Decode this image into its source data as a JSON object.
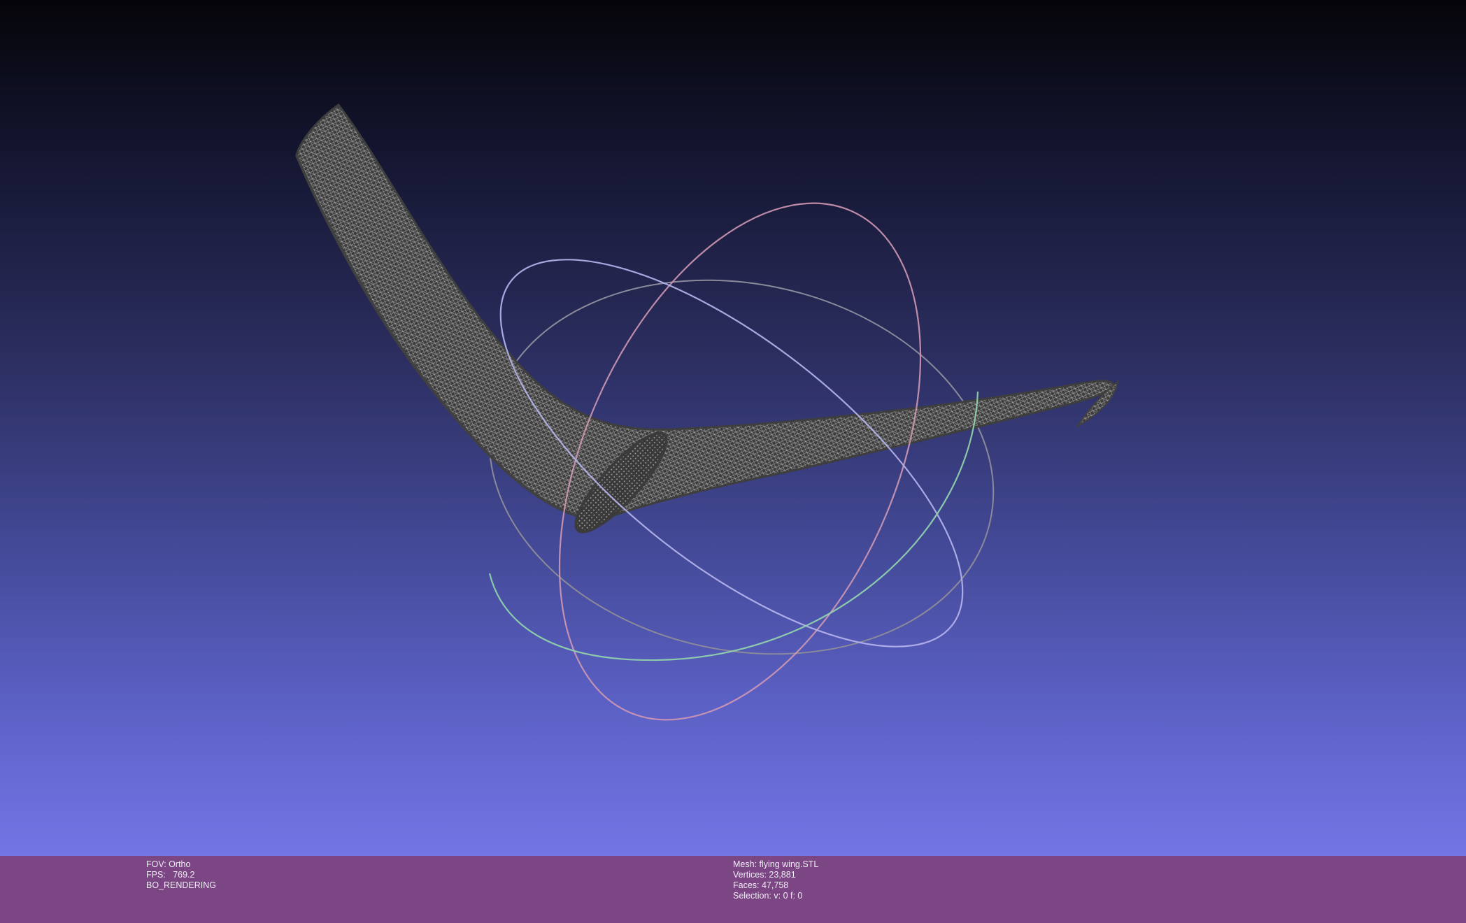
{
  "viewport": {
    "background_top": "#050509",
    "background_bottom": "#7475e6"
  },
  "mesh_view": {
    "render_mode": "wireframe",
    "mesh_color": "#4a4a4a",
    "trackball_colors": [
      "#e8a0b0",
      "#b0b0f0",
      "#90e0b0",
      "#8a8a8a"
    ]
  },
  "info_bar": {
    "background": "#7c4684",
    "left": {
      "fov": "FOV: Ortho",
      "fps": "FPS:   769.2",
      "rendering": "BO_RENDERING"
    },
    "right": {
      "mesh": "Mesh: flying wing.STL",
      "vertices": "Vertices: 23,881",
      "faces": "Faces: 47,758",
      "selection": "Selection: v: 0 f: 0"
    }
  }
}
